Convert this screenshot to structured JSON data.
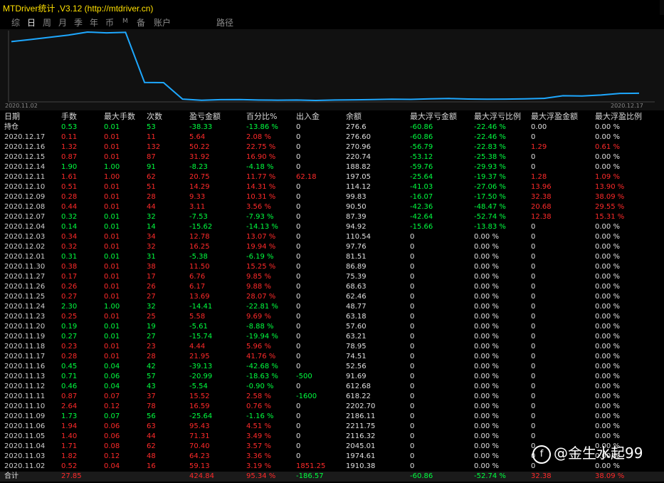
{
  "window": {
    "title": "MTDriver统计 ,V3.12 (http://mtdriver.cn)"
  },
  "toolbar": [
    {
      "label": "综",
      "active": false
    },
    {
      "label": "日",
      "active": true
    },
    {
      "label": "周",
      "active": false
    },
    {
      "label": "月",
      "active": false
    },
    {
      "label": "季",
      "active": false
    },
    {
      "label": "年",
      "active": false
    },
    {
      "label": "币",
      "active": false
    },
    {
      "label": "M",
      "active": false,
      "small": true
    },
    {
      "label": "备",
      "active": false
    },
    {
      "label": "账户",
      "active": false
    },
    {
      "label": "路径",
      "active": false
    }
  ],
  "chart_data": {
    "type": "line",
    "x_start_label": "2020.11.02",
    "x_end_label": "2020.12.17",
    "x": [
      "2020.11.02",
      "2020.11.03",
      "2020.11.04",
      "2020.11.05",
      "2020.11.06",
      "2020.11.09",
      "2020.11.10",
      "2020.11.11",
      "2020.11.12",
      "2020.11.13",
      "2020.11.16",
      "2020.11.17",
      "2020.11.18",
      "2020.11.19",
      "2020.11.20",
      "2020.11.23",
      "2020.11.24",
      "2020.11.25",
      "2020.11.26",
      "2020.11.27",
      "2020.11.30",
      "2020.12.01",
      "2020.12.02",
      "2020.12.03",
      "2020.12.04",
      "2020.12.07",
      "2020.12.08",
      "2020.12.09",
      "2020.12.10",
      "2020.12.11",
      "2020.12.14",
      "2020.12.15",
      "2020.12.16",
      "2020.12.17"
    ],
    "series": [
      {
        "values": [
          1910.38,
          1974.61,
          2045.01,
          2116.32,
          2211.75,
          2186.11,
          2202.7,
          618.22,
          612.68,
          91.69,
          52.56,
          74.51,
          78.95,
          63.21,
          57.6,
          63.18,
          48.77,
          62.46,
          68.63,
          75.39,
          86.89,
          81.51,
          97.76,
          110.54,
          94.92,
          87.39,
          90.5,
          99.83,
          114.12,
          197.05,
          188.82,
          220.74,
          270.96,
          276.6
        ]
      }
    ],
    "color": "#1ea8ff",
    "grid": false
  },
  "table": {
    "headers": [
      "日期",
      "手数",
      "最大手数",
      "次数",
      "盈亏金额",
      "百分比%",
      "出入金",
      "余额",
      "最大浮亏金额",
      "最大浮亏比例",
      "最大浮盈金额",
      "最大浮盈比例"
    ],
    "rows": [
      {
        "cells": [
          "持仓",
          "0.53",
          "0.01",
          "53",
          "-38.33",
          "-13.86 %",
          "0",
          "276.6",
          "-60.86",
          "-22.46 %",
          "0.00",
          "0.00 %"
        ],
        "colors": [
          "w",
          "g",
          "g",
          "g",
          "g",
          "g",
          "w",
          "w",
          "g",
          "g",
          "w",
          "w"
        ]
      },
      {
        "cells": [
          "2020.12.17",
          "0.11",
          "0.01",
          "11",
          "5.64",
          "2.08 %",
          "0",
          "276.60",
          "-60.86",
          "-22.46 %",
          "0",
          "0.00 %"
        ],
        "colors": [
          "d",
          "r",
          "r",
          "r",
          "r",
          "r",
          "w",
          "w",
          "g",
          "g",
          "w",
          "w"
        ]
      },
      {
        "cells": [
          "2020.12.16",
          "1.32",
          "0.01",
          "132",
          "50.22",
          "22.75 %",
          "0",
          "270.96",
          "-56.79",
          "-22.83 %",
          "1.29",
          "0.61 %"
        ],
        "colors": [
          "d",
          "r",
          "r",
          "r",
          "r",
          "r",
          "w",
          "w",
          "g",
          "g",
          "r",
          "r"
        ]
      },
      {
        "cells": [
          "2020.12.15",
          "0.87",
          "0.01",
          "87",
          "31.92",
          "16.90 %",
          "0",
          "220.74",
          "-53.12",
          "-25.38 %",
          "0",
          "0.00 %"
        ],
        "colors": [
          "d",
          "r",
          "r",
          "r",
          "r",
          "r",
          "w",
          "w",
          "g",
          "g",
          "w",
          "w"
        ]
      },
      {
        "cells": [
          "2020.12.14",
          "1.90",
          "1.00",
          "91",
          "-8.23",
          "-4.18 %",
          "0",
          "188.82",
          "-59.76",
          "-29.93 %",
          "0",
          "0.00 %"
        ],
        "colors": [
          "d",
          "g",
          "g",
          "g",
          "g",
          "g",
          "w",
          "w",
          "g",
          "g",
          "w",
          "w"
        ]
      },
      {
        "cells": [
          "2020.12.11",
          "1.61",
          "1.00",
          "62",
          "20.75",
          "11.77 %",
          "62.18",
          "197.05",
          "-25.64",
          "-19.37 %",
          "1.28",
          "1.09 %"
        ],
        "colors": [
          "d",
          "r",
          "r",
          "r",
          "r",
          "r",
          "r",
          "w",
          "g",
          "g",
          "r",
          "r"
        ]
      },
      {
        "cells": [
          "2020.12.10",
          "0.51",
          "0.01",
          "51",
          "14.29",
          "14.31 %",
          "0",
          "114.12",
          "-41.03",
          "-27.06 %",
          "13.96",
          "13.90 %"
        ],
        "colors": [
          "d",
          "r",
          "r",
          "r",
          "r",
          "r",
          "w",
          "w",
          "g",
          "g",
          "r",
          "r"
        ]
      },
      {
        "cells": [
          "2020.12.09",
          "0.28",
          "0.01",
          "28",
          "9.33",
          "10.31 %",
          "0",
          "99.83",
          "-16.07",
          "-17.50 %",
          "32.38",
          "38.09 %"
        ],
        "colors": [
          "d",
          "r",
          "r",
          "r",
          "r",
          "r",
          "w",
          "w",
          "g",
          "g",
          "r",
          "r"
        ]
      },
      {
        "cells": [
          "2020.12.08",
          "0.44",
          "0.01",
          "44",
          "3.11",
          "3.56 %",
          "0",
          "90.50",
          "-42.36",
          "-48.47 %",
          "20.68",
          "29.55 %"
        ],
        "colors": [
          "d",
          "r",
          "r",
          "r",
          "r",
          "r",
          "w",
          "w",
          "g",
          "g",
          "r",
          "r"
        ]
      },
      {
        "cells": [
          "2020.12.07",
          "0.32",
          "0.01",
          "32",
          "-7.53",
          "-7.93 %",
          "0",
          "87.39",
          "-42.64",
          "-52.74 %",
          "12.38",
          "15.31 %"
        ],
        "colors": [
          "d",
          "g",
          "g",
          "g",
          "g",
          "g",
          "w",
          "w",
          "g",
          "g",
          "r",
          "r"
        ]
      },
      {
        "cells": [
          "2020.12.04",
          "0.14",
          "0.01",
          "14",
          "-15.62",
          "-14.13 %",
          "0",
          "94.92",
          "-15.66",
          "-13.83 %",
          "0",
          "0.00 %"
        ],
        "colors": [
          "d",
          "g",
          "g",
          "g",
          "g",
          "g",
          "w",
          "w",
          "g",
          "g",
          "w",
          "w"
        ]
      },
      {
        "cells": [
          "2020.12.03",
          "0.34",
          "0.01",
          "34",
          "12.78",
          "13.07 %",
          "0",
          "110.54",
          "0",
          "0.00 %",
          "0",
          "0.00 %"
        ],
        "colors": [
          "d",
          "r",
          "r",
          "r",
          "r",
          "r",
          "w",
          "w",
          "w",
          "w",
          "w",
          "w"
        ]
      },
      {
        "cells": [
          "2020.12.02",
          "0.32",
          "0.01",
          "32",
          "16.25",
          "19.94 %",
          "0",
          "97.76",
          "0",
          "0.00 %",
          "0",
          "0.00 %"
        ],
        "colors": [
          "d",
          "r",
          "r",
          "r",
          "r",
          "r",
          "w",
          "w",
          "w",
          "w",
          "w",
          "w"
        ]
      },
      {
        "cells": [
          "2020.12.01",
          "0.31",
          "0.01",
          "31",
          "-5.38",
          "-6.19 %",
          "0",
          "81.51",
          "0",
          "0.00 %",
          "0",
          "0.00 %"
        ],
        "colors": [
          "d",
          "g",
          "g",
          "g",
          "g",
          "g",
          "w",
          "w",
          "w",
          "w",
          "w",
          "w"
        ]
      },
      {
        "cells": [
          "2020.11.30",
          "0.38",
          "0.01",
          "38",
          "11.50",
          "15.25 %",
          "0",
          "86.89",
          "0",
          "0.00 %",
          "0",
          "0.00 %"
        ],
        "colors": [
          "d",
          "r",
          "r",
          "r",
          "r",
          "r",
          "w",
          "w",
          "w",
          "w",
          "w",
          "w"
        ]
      },
      {
        "cells": [
          "2020.11.27",
          "0.17",
          "0.01",
          "17",
          "6.76",
          "9.85 %",
          "0",
          "75.39",
          "0",
          "0.00 %",
          "0",
          "0.00 %"
        ],
        "colors": [
          "d",
          "r",
          "r",
          "r",
          "r",
          "r",
          "w",
          "w",
          "w",
          "w",
          "w",
          "w"
        ]
      },
      {
        "cells": [
          "2020.11.26",
          "0.26",
          "0.01",
          "26",
          "6.17",
          "9.88 %",
          "0",
          "68.63",
          "0",
          "0.00 %",
          "0",
          "0.00 %"
        ],
        "colors": [
          "d",
          "r",
          "r",
          "r",
          "r",
          "r",
          "w",
          "w",
          "w",
          "w",
          "w",
          "w"
        ]
      },
      {
        "cells": [
          "2020.11.25",
          "0.27",
          "0.01",
          "27",
          "13.69",
          "28.07 %",
          "0",
          "62.46",
          "0",
          "0.00 %",
          "0",
          "0.00 %"
        ],
        "colors": [
          "d",
          "r",
          "r",
          "r",
          "r",
          "r",
          "w",
          "w",
          "w",
          "w",
          "w",
          "w"
        ]
      },
      {
        "cells": [
          "2020.11.24",
          "2.30",
          "1.00",
          "32",
          "-14.41",
          "-22.81 %",
          "0",
          "48.77",
          "0",
          "0.00 %",
          "0",
          "0.00 %"
        ],
        "colors": [
          "d",
          "g",
          "g",
          "g",
          "g",
          "g",
          "w",
          "w",
          "w",
          "w",
          "w",
          "w"
        ]
      },
      {
        "cells": [
          "2020.11.23",
          "0.25",
          "0.01",
          "25",
          "5.58",
          "9.69 %",
          "0",
          "63.18",
          "0",
          "0.00 %",
          "0",
          "0.00 %"
        ],
        "colors": [
          "d",
          "r",
          "r",
          "r",
          "r",
          "r",
          "w",
          "w",
          "w",
          "w",
          "w",
          "w"
        ]
      },
      {
        "cells": [
          "2020.11.20",
          "0.19",
          "0.01",
          "19",
          "-5.61",
          "-8.88 %",
          "0",
          "57.60",
          "0",
          "0.00 %",
          "0",
          "0.00 %"
        ],
        "colors": [
          "d",
          "g",
          "g",
          "g",
          "g",
          "g",
          "w",
          "w",
          "w",
          "w",
          "w",
          "w"
        ]
      },
      {
        "cells": [
          "2020.11.19",
          "0.27",
          "0.01",
          "27",
          "-15.74",
          "-19.94 %",
          "0",
          "63.21",
          "0",
          "0.00 %",
          "0",
          "0.00 %"
        ],
        "colors": [
          "d",
          "g",
          "g",
          "g",
          "g",
          "g",
          "w",
          "w",
          "w",
          "w",
          "w",
          "w"
        ]
      },
      {
        "cells": [
          "2020.11.18",
          "0.23",
          "0.01",
          "23",
          "4.44",
          "5.96 %",
          "0",
          "78.95",
          "0",
          "0.00 %",
          "0",
          "0.00 %"
        ],
        "colors": [
          "d",
          "r",
          "r",
          "r",
          "r",
          "r",
          "w",
          "w",
          "w",
          "w",
          "w",
          "w"
        ]
      },
      {
        "cells": [
          "2020.11.17",
          "0.28",
          "0.01",
          "28",
          "21.95",
          "41.76 %",
          "0",
          "74.51",
          "0",
          "0.00 %",
          "0",
          "0.00 %"
        ],
        "colors": [
          "d",
          "r",
          "r",
          "r",
          "r",
          "r",
          "w",
          "w",
          "w",
          "w",
          "w",
          "w"
        ]
      },
      {
        "cells": [
          "2020.11.16",
          "0.45",
          "0.04",
          "42",
          "-39.13",
          "-42.68 %",
          "0",
          "52.56",
          "0",
          "0.00 %",
          "0",
          "0.00 %"
        ],
        "colors": [
          "d",
          "g",
          "g",
          "g",
          "g",
          "g",
          "w",
          "w",
          "w",
          "w",
          "w",
          "w"
        ]
      },
      {
        "cells": [
          "2020.11.13",
          "0.71",
          "0.06",
          "57",
          "-20.99",
          "-18.63 %",
          "-500",
          "91.69",
          "0",
          "0.00 %",
          "0",
          "0.00 %"
        ],
        "colors": [
          "d",
          "g",
          "g",
          "g",
          "g",
          "g",
          "g",
          "w",
          "w",
          "w",
          "w",
          "w"
        ]
      },
      {
        "cells": [
          "2020.11.12",
          "0.46",
          "0.04",
          "43",
          "-5.54",
          "-0.90 %",
          "0",
          "612.68",
          "0",
          "0.00 %",
          "0",
          "0.00 %"
        ],
        "colors": [
          "d",
          "g",
          "g",
          "g",
          "g",
          "g",
          "w",
          "w",
          "w",
          "w",
          "w",
          "w"
        ]
      },
      {
        "cells": [
          "2020.11.11",
          "0.87",
          "0.07",
          "37",
          "15.52",
          "2.58 %",
          "-1600",
          "618.22",
          "0",
          "0.00 %",
          "0",
          "0.00 %"
        ],
        "colors": [
          "d",
          "r",
          "r",
          "r",
          "r",
          "r",
          "g",
          "w",
          "w",
          "w",
          "w",
          "w"
        ]
      },
      {
        "cells": [
          "2020.11.10",
          "2.64",
          "0.12",
          "78",
          "16.59",
          "0.76 %",
          "0",
          "2202.70",
          "0",
          "0.00 %",
          "0",
          "0.00 %"
        ],
        "colors": [
          "d",
          "r",
          "r",
          "r",
          "r",
          "r",
          "w",
          "w",
          "w",
          "w",
          "w",
          "w"
        ]
      },
      {
        "cells": [
          "2020.11.09",
          "1.73",
          "0.07",
          "56",
          "-25.64",
          "-1.16 %",
          "0",
          "2186.11",
          "0",
          "0.00 %",
          "0",
          "0.00 %"
        ],
        "colors": [
          "d",
          "g",
          "g",
          "g",
          "g",
          "g",
          "w",
          "w",
          "w",
          "w",
          "w",
          "w"
        ]
      },
      {
        "cells": [
          "2020.11.06",
          "1.94",
          "0.06",
          "63",
          "95.43",
          "4.51 %",
          "0",
          "2211.75",
          "0",
          "0.00 %",
          "0",
          "0.00 %"
        ],
        "colors": [
          "d",
          "r",
          "r",
          "r",
          "r",
          "r",
          "w",
          "w",
          "w",
          "w",
          "w",
          "w"
        ]
      },
      {
        "cells": [
          "2020.11.05",
          "1.40",
          "0.06",
          "44",
          "71.31",
          "3.49 %",
          "0",
          "2116.32",
          "0",
          "0.00 %",
          "0",
          "0.00 %"
        ],
        "colors": [
          "d",
          "r",
          "r",
          "r",
          "r",
          "r",
          "w",
          "w",
          "w",
          "w",
          "w",
          "w"
        ]
      },
      {
        "cells": [
          "2020.11.04",
          "1.71",
          "0.08",
          "62",
          "70.40",
          "3.57 %",
          "0",
          "2045.01",
          "0",
          "0.00 %",
          "0",
          "0.00 %"
        ],
        "colors": [
          "d",
          "r",
          "r",
          "r",
          "r",
          "r",
          "w",
          "w",
          "w",
          "w",
          "w",
          "w"
        ]
      },
      {
        "cells": [
          "2020.11.03",
          "1.82",
          "0.12",
          "48",
          "64.23",
          "3.36 %",
          "0",
          "1974.61",
          "0",
          "0.00 %",
          "0",
          "0.00 %"
        ],
        "colors": [
          "d",
          "r",
          "r",
          "r",
          "r",
          "r",
          "w",
          "w",
          "w",
          "w",
          "w",
          "w"
        ]
      },
      {
        "cells": [
          "2020.11.02",
          "0.52",
          "0.04",
          "16",
          "59.13",
          "3.19 %",
          "1851.25",
          "1910.38",
          "0",
          "0.00 %",
          "0",
          "0.00 %"
        ],
        "colors": [
          "d",
          "r",
          "r",
          "r",
          "r",
          "r",
          "r",
          "w",
          "w",
          "w",
          "w",
          "w"
        ]
      }
    ],
    "total": {
      "cells": [
        "合计",
        "27.85",
        "",
        "",
        "424.84",
        "95.34 %",
        "-186.57",
        "",
        "-60.86",
        "-52.74 %",
        "32.38",
        "38.09 %"
      ],
      "colors": [
        "w",
        "r",
        "w",
        "w",
        "r",
        "r",
        "g",
        "w",
        "g",
        "g",
        "r",
        "r"
      ]
    }
  },
  "watermark": {
    "logo": "f",
    "text": "@金生水起99"
  }
}
